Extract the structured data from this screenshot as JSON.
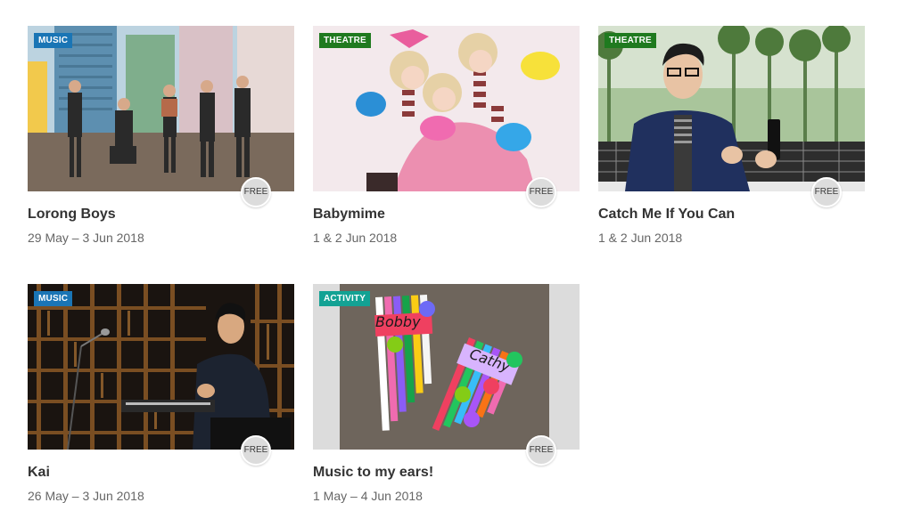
{
  "colors": {
    "music_tag": "#1a75b5",
    "theatre_tag": "#1f7a1f",
    "activity_tag": "#13a294",
    "title_text": "#333333",
    "date_text": "#666666",
    "free_badge": "#dcdcdc"
  },
  "events": [
    {
      "category": "MUSIC",
      "badge": "FREE",
      "title": "Lorong Boys",
      "dates": "29 May – 3 Jun 2018"
    },
    {
      "category": "THEATRE",
      "badge": "FREE",
      "title": "Babymime",
      "dates": "1 & 2 Jun 2018"
    },
    {
      "category": "THEATRE",
      "badge": "FREE",
      "title": "Catch Me If You Can",
      "dates": "1 & 2 Jun 2018"
    },
    {
      "category": "MUSIC",
      "badge": "FREE",
      "title": "Kai",
      "dates": "26 May – 3 Jun 2018"
    },
    {
      "category": "ACTIVITY",
      "badge": "FREE",
      "title": "Music to my ears!",
      "dates": "1 May – 4 Jun 2018"
    }
  ],
  "image_text": {
    "name_tag_1": "Bobby",
    "name_tag_2": "Cathy"
  }
}
